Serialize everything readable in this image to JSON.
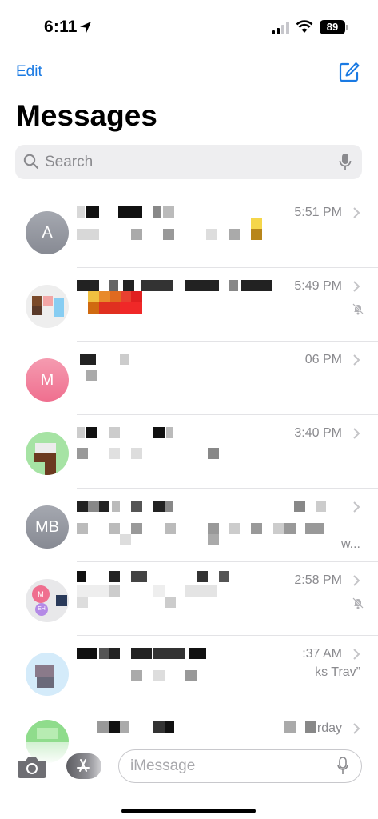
{
  "status_bar": {
    "time": "6:11",
    "battery": "89"
  },
  "header": {
    "edit_label": "Edit",
    "title": "Messages"
  },
  "search": {
    "placeholder": "Search"
  },
  "conversations": [
    {
      "avatar": "A",
      "time": "5:51 PM",
      "sub": ""
    },
    {
      "avatar": "",
      "time": "5:49 PM",
      "sub": ""
    },
    {
      "avatar": "M",
      "time": "06 PM",
      "sub": ""
    },
    {
      "avatar": "",
      "time": "3:40 PM",
      "sub": ""
    },
    {
      "avatar": "MB",
      "time": "",
      "sub": "w..."
    },
    {
      "avatar": "M",
      "avatar_secondary": "EH",
      "time": "2:58 PM",
      "sub": ""
    },
    {
      "avatar": "",
      "time": ":37 AM",
      "sub": "ks Trav”"
    },
    {
      "avatar": "",
      "time": "rday",
      "sub": ""
    }
  ],
  "composer": {
    "placeholder": "iMessage"
  },
  "colors": {
    "accent": "#1a7ae3",
    "secondary_text": "#8a8a8e",
    "search_bg": "#eeeef0"
  }
}
